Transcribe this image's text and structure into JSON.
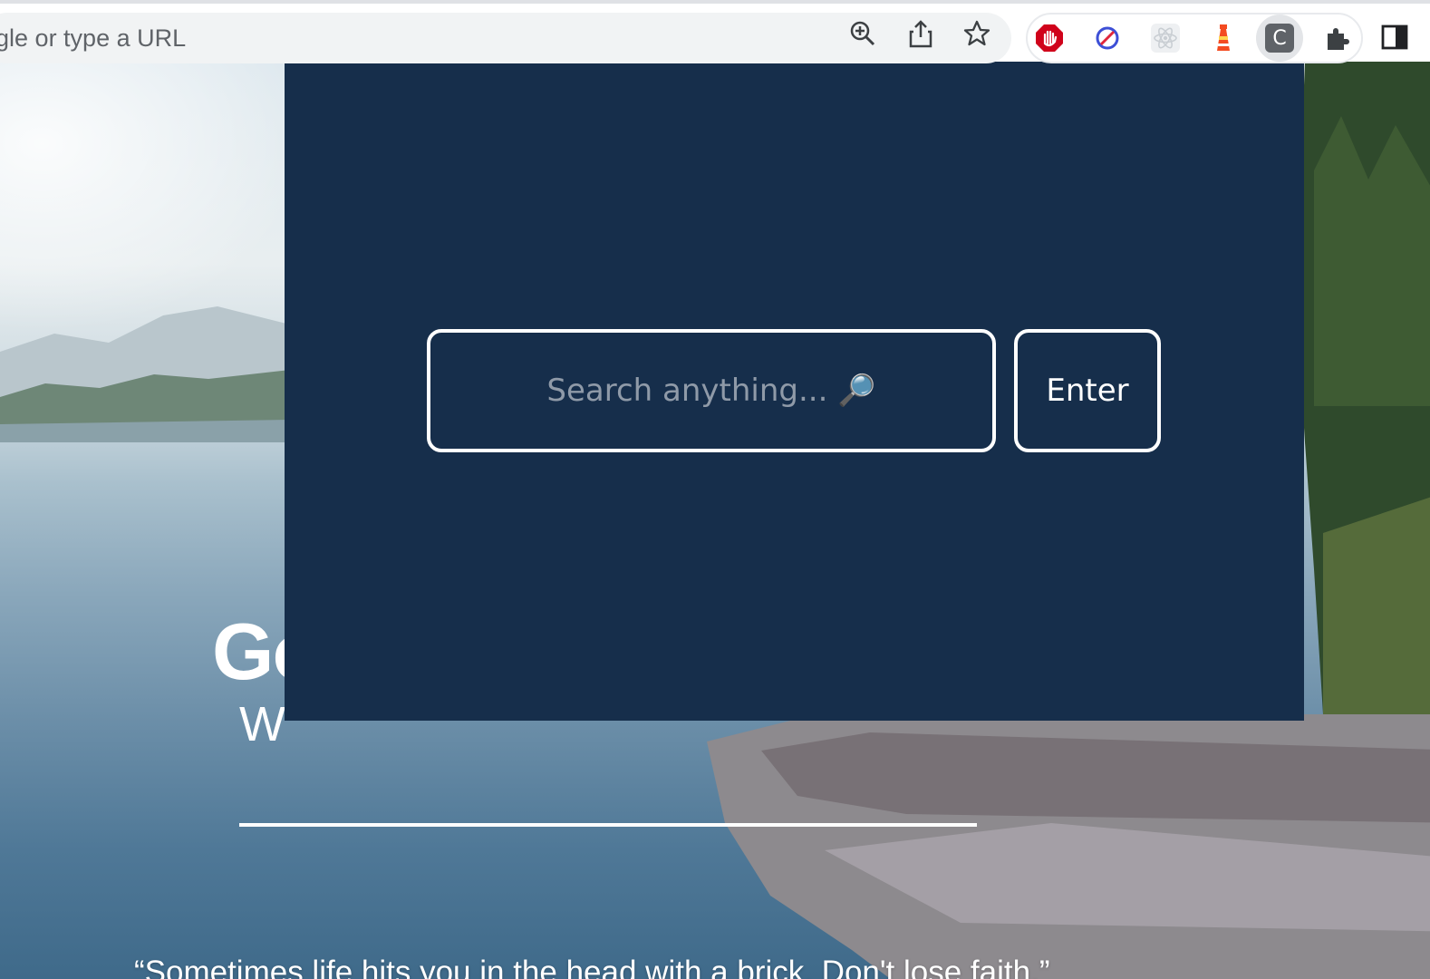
{
  "browser": {
    "omnibox_text": "ogle or type a URL",
    "icons": {
      "zoom": "zoom-in-icon",
      "share": "share-icon",
      "bookmark": "star-icon",
      "extensions": [
        "adblock-icon",
        "block-site-icon",
        "react-devtools-icon",
        "lighthouse-icon",
        "c-extension-icon",
        "puzzle-icon"
      ],
      "sidepanel": "side-panel-icon"
    },
    "active_extension_letter": "C"
  },
  "background": {
    "greeting_visible": "Go",
    "sub_greeting_visible": "W",
    "quote": "“Sometimes life hits you in the head with a brick. Don't lose faith.”"
  },
  "popup": {
    "search_placeholder": "Search anything... 🔎",
    "search_value": "",
    "enter_label": "Enter"
  },
  "colors": {
    "popup_bg": "#162e4b",
    "border": "#ffffff",
    "placeholder": "#8f9aa8"
  }
}
